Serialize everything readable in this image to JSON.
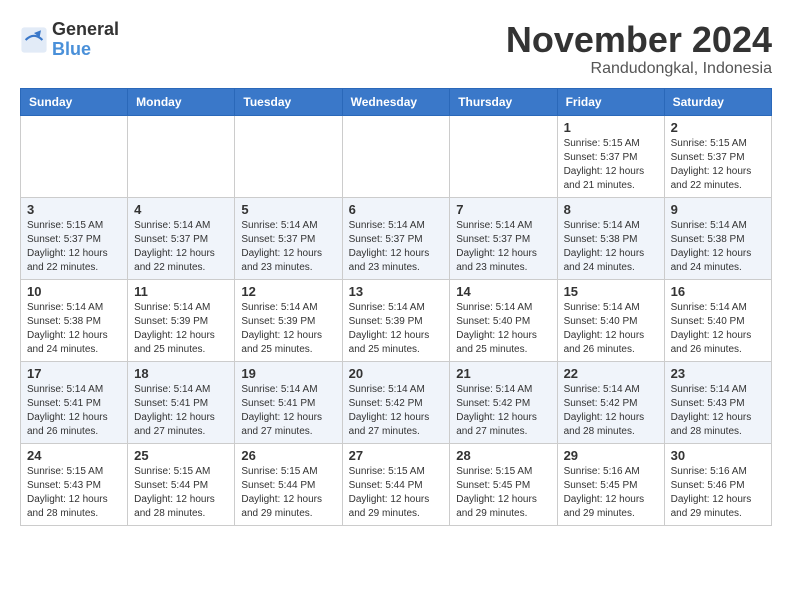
{
  "header": {
    "logo_line1": "General",
    "logo_line2": "Blue",
    "month": "November 2024",
    "location": "Randudongkal, Indonesia"
  },
  "weekdays": [
    "Sunday",
    "Monday",
    "Tuesday",
    "Wednesday",
    "Thursday",
    "Friday",
    "Saturday"
  ],
  "weeks": [
    [
      {
        "day": "",
        "info": ""
      },
      {
        "day": "",
        "info": ""
      },
      {
        "day": "",
        "info": ""
      },
      {
        "day": "",
        "info": ""
      },
      {
        "day": "",
        "info": ""
      },
      {
        "day": "1",
        "info": "Sunrise: 5:15 AM\nSunset: 5:37 PM\nDaylight: 12 hours\nand 21 minutes."
      },
      {
        "day": "2",
        "info": "Sunrise: 5:15 AM\nSunset: 5:37 PM\nDaylight: 12 hours\nand 22 minutes."
      }
    ],
    [
      {
        "day": "3",
        "info": "Sunrise: 5:15 AM\nSunset: 5:37 PM\nDaylight: 12 hours\nand 22 minutes."
      },
      {
        "day": "4",
        "info": "Sunrise: 5:14 AM\nSunset: 5:37 PM\nDaylight: 12 hours\nand 22 minutes."
      },
      {
        "day": "5",
        "info": "Sunrise: 5:14 AM\nSunset: 5:37 PM\nDaylight: 12 hours\nand 23 minutes."
      },
      {
        "day": "6",
        "info": "Sunrise: 5:14 AM\nSunset: 5:37 PM\nDaylight: 12 hours\nand 23 minutes."
      },
      {
        "day": "7",
        "info": "Sunrise: 5:14 AM\nSunset: 5:37 PM\nDaylight: 12 hours\nand 23 minutes."
      },
      {
        "day": "8",
        "info": "Sunrise: 5:14 AM\nSunset: 5:38 PM\nDaylight: 12 hours\nand 24 minutes."
      },
      {
        "day": "9",
        "info": "Sunrise: 5:14 AM\nSunset: 5:38 PM\nDaylight: 12 hours\nand 24 minutes."
      }
    ],
    [
      {
        "day": "10",
        "info": "Sunrise: 5:14 AM\nSunset: 5:38 PM\nDaylight: 12 hours\nand 24 minutes."
      },
      {
        "day": "11",
        "info": "Sunrise: 5:14 AM\nSunset: 5:39 PM\nDaylight: 12 hours\nand 25 minutes."
      },
      {
        "day": "12",
        "info": "Sunrise: 5:14 AM\nSunset: 5:39 PM\nDaylight: 12 hours\nand 25 minutes."
      },
      {
        "day": "13",
        "info": "Sunrise: 5:14 AM\nSunset: 5:39 PM\nDaylight: 12 hours\nand 25 minutes."
      },
      {
        "day": "14",
        "info": "Sunrise: 5:14 AM\nSunset: 5:40 PM\nDaylight: 12 hours\nand 25 minutes."
      },
      {
        "day": "15",
        "info": "Sunrise: 5:14 AM\nSunset: 5:40 PM\nDaylight: 12 hours\nand 26 minutes."
      },
      {
        "day": "16",
        "info": "Sunrise: 5:14 AM\nSunset: 5:40 PM\nDaylight: 12 hours\nand 26 minutes."
      }
    ],
    [
      {
        "day": "17",
        "info": "Sunrise: 5:14 AM\nSunset: 5:41 PM\nDaylight: 12 hours\nand 26 minutes."
      },
      {
        "day": "18",
        "info": "Sunrise: 5:14 AM\nSunset: 5:41 PM\nDaylight: 12 hours\nand 27 minutes."
      },
      {
        "day": "19",
        "info": "Sunrise: 5:14 AM\nSunset: 5:41 PM\nDaylight: 12 hours\nand 27 minutes."
      },
      {
        "day": "20",
        "info": "Sunrise: 5:14 AM\nSunset: 5:42 PM\nDaylight: 12 hours\nand 27 minutes."
      },
      {
        "day": "21",
        "info": "Sunrise: 5:14 AM\nSunset: 5:42 PM\nDaylight: 12 hours\nand 27 minutes."
      },
      {
        "day": "22",
        "info": "Sunrise: 5:14 AM\nSunset: 5:42 PM\nDaylight: 12 hours\nand 28 minutes."
      },
      {
        "day": "23",
        "info": "Sunrise: 5:14 AM\nSunset: 5:43 PM\nDaylight: 12 hours\nand 28 minutes."
      }
    ],
    [
      {
        "day": "24",
        "info": "Sunrise: 5:15 AM\nSunset: 5:43 PM\nDaylight: 12 hours\nand 28 minutes."
      },
      {
        "day": "25",
        "info": "Sunrise: 5:15 AM\nSunset: 5:44 PM\nDaylight: 12 hours\nand 28 minutes."
      },
      {
        "day": "26",
        "info": "Sunrise: 5:15 AM\nSunset: 5:44 PM\nDaylight: 12 hours\nand 29 minutes."
      },
      {
        "day": "27",
        "info": "Sunrise: 5:15 AM\nSunset: 5:44 PM\nDaylight: 12 hours\nand 29 minutes."
      },
      {
        "day": "28",
        "info": "Sunrise: 5:15 AM\nSunset: 5:45 PM\nDaylight: 12 hours\nand 29 minutes."
      },
      {
        "day": "29",
        "info": "Sunrise: 5:16 AM\nSunset: 5:45 PM\nDaylight: 12 hours\nand 29 minutes."
      },
      {
        "day": "30",
        "info": "Sunrise: 5:16 AM\nSunset: 5:46 PM\nDaylight: 12 hours\nand 29 minutes."
      }
    ]
  ]
}
